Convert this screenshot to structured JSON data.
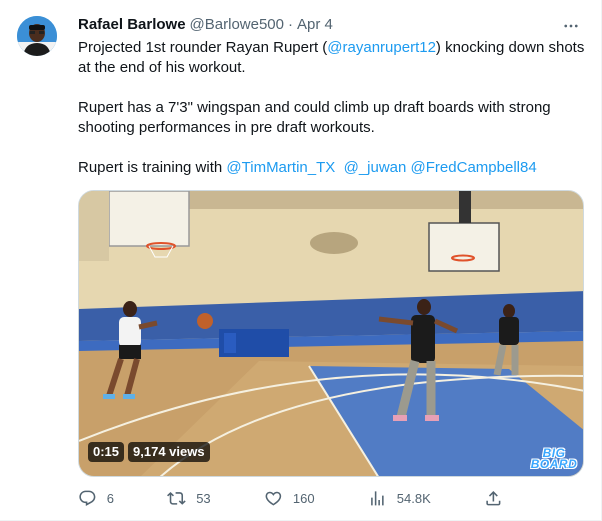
{
  "author": {
    "name": "Rafael Barlowe",
    "handle": "@Barlowe500",
    "separator": "·",
    "date": "Apr 4"
  },
  "tweet": {
    "p1_prefix": "Projected 1st rounder Rayan Rupert (",
    "p1_mention": "@rayanrupert12",
    "p1_suffix": ") knocking down shots at the end of his workout.",
    "p2": "Rupert has a 7'3\" wingspan and could climb up draft boards with strong shooting performances in pre draft workouts.",
    "p3_prefix": "Rupert is training with ",
    "mentions": [
      "@TimMartin_TX",
      "@_juwan",
      "@FredCampbell84"
    ]
  },
  "video": {
    "duration": "0:15",
    "views": "9,174 views",
    "watermark_line1": "BIG",
    "watermark_line2": "BOARD"
  },
  "actions": {
    "replies": "6",
    "retweets": "53",
    "likes": "160",
    "views": "54.8K"
  },
  "icons": {
    "more": "more-icon",
    "reply": "reply-icon",
    "retweet": "retweet-icon",
    "like": "heart-icon",
    "views": "analytics-icon",
    "share": "share-icon"
  },
  "colors": {
    "link": "#1d9bf0",
    "secondary": "#536471",
    "text": "#0f1419"
  }
}
